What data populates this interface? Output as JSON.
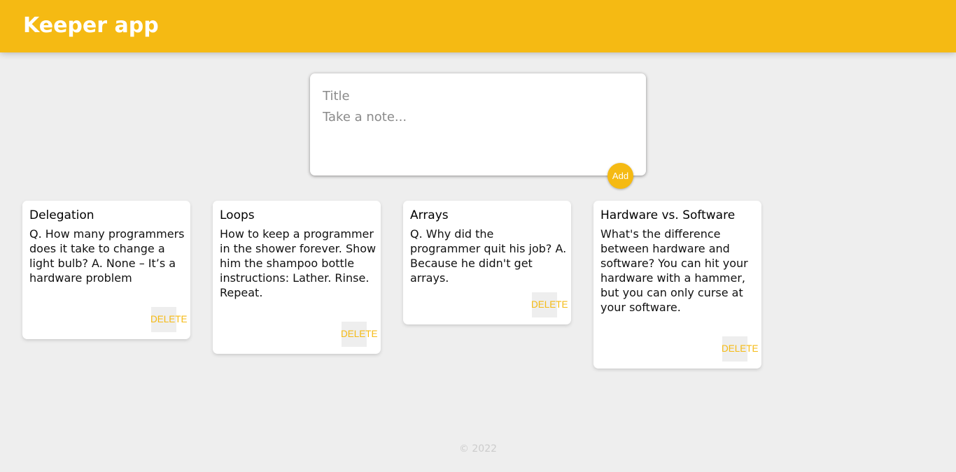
{
  "app": {
    "title": "Keeper app"
  },
  "create_note": {
    "title_placeholder": "Title",
    "content_placeholder": "Take a note...",
    "add_label": "Add"
  },
  "notes": [
    {
      "title": "Delegation",
      "content": "Q. How many programmers does it take to change a light bulb? A. None – It’s a hardware problem",
      "delete_label": "DELETE"
    },
    {
      "title": "Loops",
      "content": "How to keep a programmer in the shower forever. Show him the shampoo bottle instructions: Lather. Rinse. Repeat.",
      "delete_label": "DELETE"
    },
    {
      "title": "Arrays",
      "content": "Q. Why did the programmer quit his job? A. Because he didn't get arrays.",
      "delete_label": "DELETE"
    },
    {
      "title": "Hardware vs. Software",
      "content": "What's the difference between hardware and software? You can hit your hardware with a hammer, but you can only curse at your software.",
      "delete_label": "DELETE"
    }
  ],
  "footer": {
    "text": "© 2022"
  },
  "colors": {
    "accent": "#f5ba13",
    "background": "#eeeeee",
    "card": "#ffffff"
  }
}
